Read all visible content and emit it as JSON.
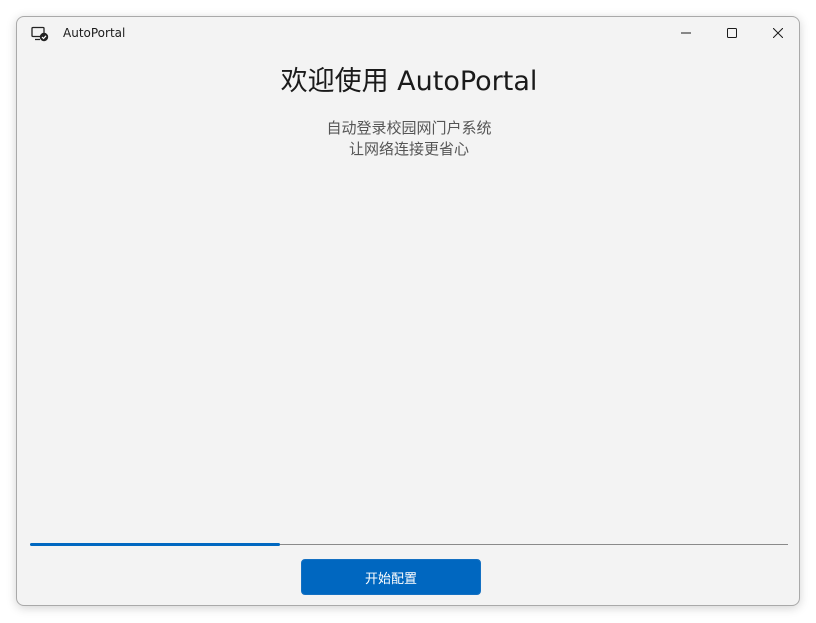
{
  "window": {
    "title": "AutoPortal",
    "app_icon": "monitor-check-icon",
    "controls": {
      "minimize": "minimize-icon",
      "maximize": "maximize-icon",
      "close": "close-icon"
    }
  },
  "main": {
    "headline": "欢迎使用 AutoPortal",
    "subtitle_line1": "自动登录校园网门户系统",
    "subtitle_line2": "让网络连接更省心"
  },
  "progress": {
    "fraction": 0.33
  },
  "actions": {
    "start_label": "开始配置"
  },
  "colors": {
    "accent": "#0067c0",
    "background": "#f3f3f3"
  }
}
